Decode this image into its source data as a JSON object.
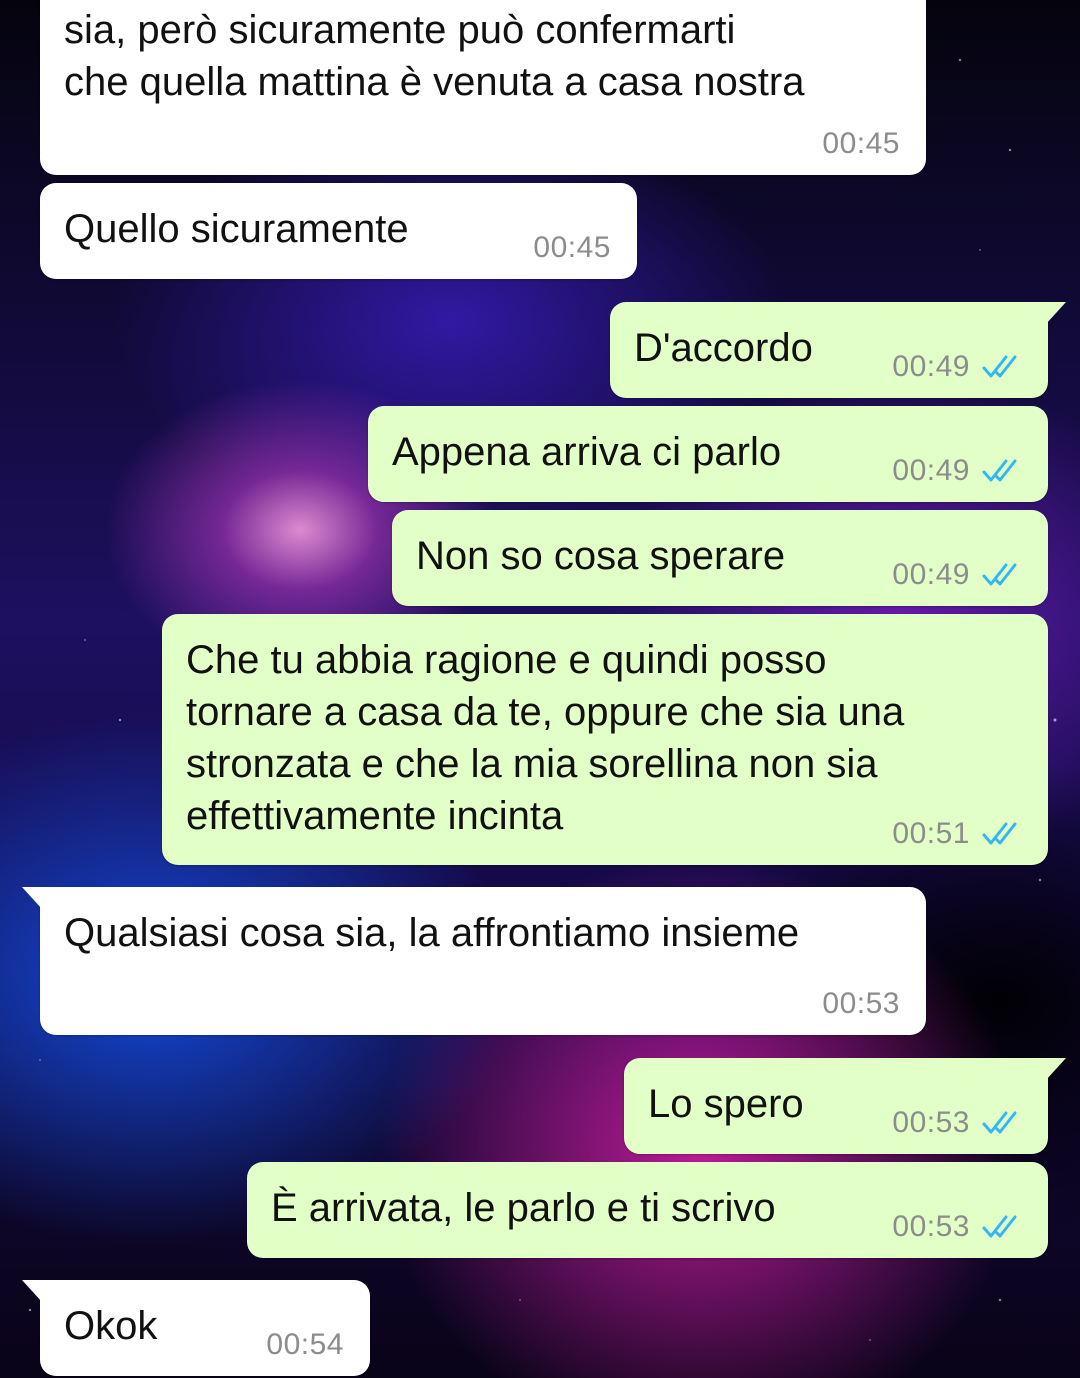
{
  "messages": [
    {
      "direction": "in",
      "text": "sia, però sicuramente può confermarti\nche quella mattina è venuta a casa nostra",
      "time": "00:45"
    },
    {
      "direction": "in",
      "text": "Quello sicuramente",
      "time": "00:45"
    },
    {
      "direction": "out",
      "text": "D'accordo",
      "time": "00:49",
      "status": "read"
    },
    {
      "direction": "out",
      "text": "Appena arriva ci parlo",
      "time": "00:49",
      "status": "read"
    },
    {
      "direction": "out",
      "text": "Non so cosa sperare",
      "time": "00:49",
      "status": "read"
    },
    {
      "direction": "out",
      "text": "Che tu abbia ragione e quindi posso\ntornare a casa da te, oppure che sia una\nstronzata e che la mia sorellina non sia\neffettivamente incinta",
      "time": "00:51",
      "status": "read"
    },
    {
      "direction": "in",
      "text": "Qualsiasi cosa sia, la affrontiamo insieme",
      "time": "00:53"
    },
    {
      "direction": "out",
      "text": "Lo spero",
      "time": "00:53",
      "status": "read"
    },
    {
      "direction": "out",
      "text": "È arrivata, le parlo e ti scrivo",
      "time": "00:53",
      "status": "read"
    },
    {
      "direction": "in",
      "text": "Okok",
      "time": "00:54"
    }
  ],
  "colors": {
    "incoming_bubble": "#ffffff",
    "outgoing_bubble": "#e2ffc8",
    "read_ticks": "#34b7f1",
    "time_text": "#8c8c8c"
  },
  "icons": {
    "read_receipt": "double-check-icon"
  }
}
